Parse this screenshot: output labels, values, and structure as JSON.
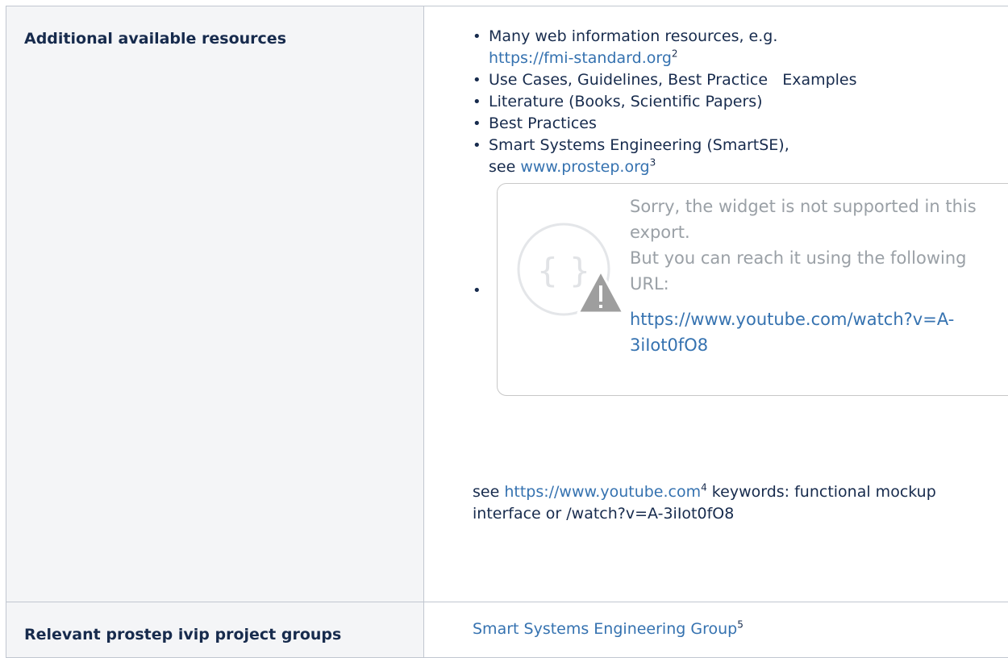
{
  "rows": [
    {
      "label": "Additional available resources",
      "items": {
        "item1_text": "Many web information resources, e.g.",
        "item1_link": "https://fmi-standard.org",
        "item1_sup": "2",
        "item2": "Use Cases, Guidelines, Best Practice   Examples",
        "item3": "Literature (Books, Scientific Papers)",
        "item4": "Best Practices",
        "item5_text": "Smart Systems Engineering (SmartSE),",
        "item5_see": "see ",
        "item5_link": "www.prostep.org",
        "item5_sup": "3"
      },
      "widget": {
        "line1": "Sorry, the widget is not supported in this export.",
        "line2": "But you can reach it using the following URL:",
        "url": "https://www.youtube.com/watch?v=A-3iIot0fO8"
      },
      "see_text": {
        "prefix": "see ",
        "link": "https://www.youtube.com",
        "sup": "4",
        "suffix": " keywords: functional mockup interface or /watch?v=A-3iIot0fO8"
      }
    },
    {
      "label": "Relevant prostep ivip project groups",
      "link": "Smart Systems Engineering Group",
      "sup": "5"
    }
  ],
  "icons": {
    "widget": "code-braces-warning-icon",
    "bullet": "bullet-icon"
  },
  "colors": {
    "link": "#3572b0",
    "header_bg": "#f4f5f7",
    "border": "#c1c7d0",
    "muted_text": "#9aa0a6"
  }
}
